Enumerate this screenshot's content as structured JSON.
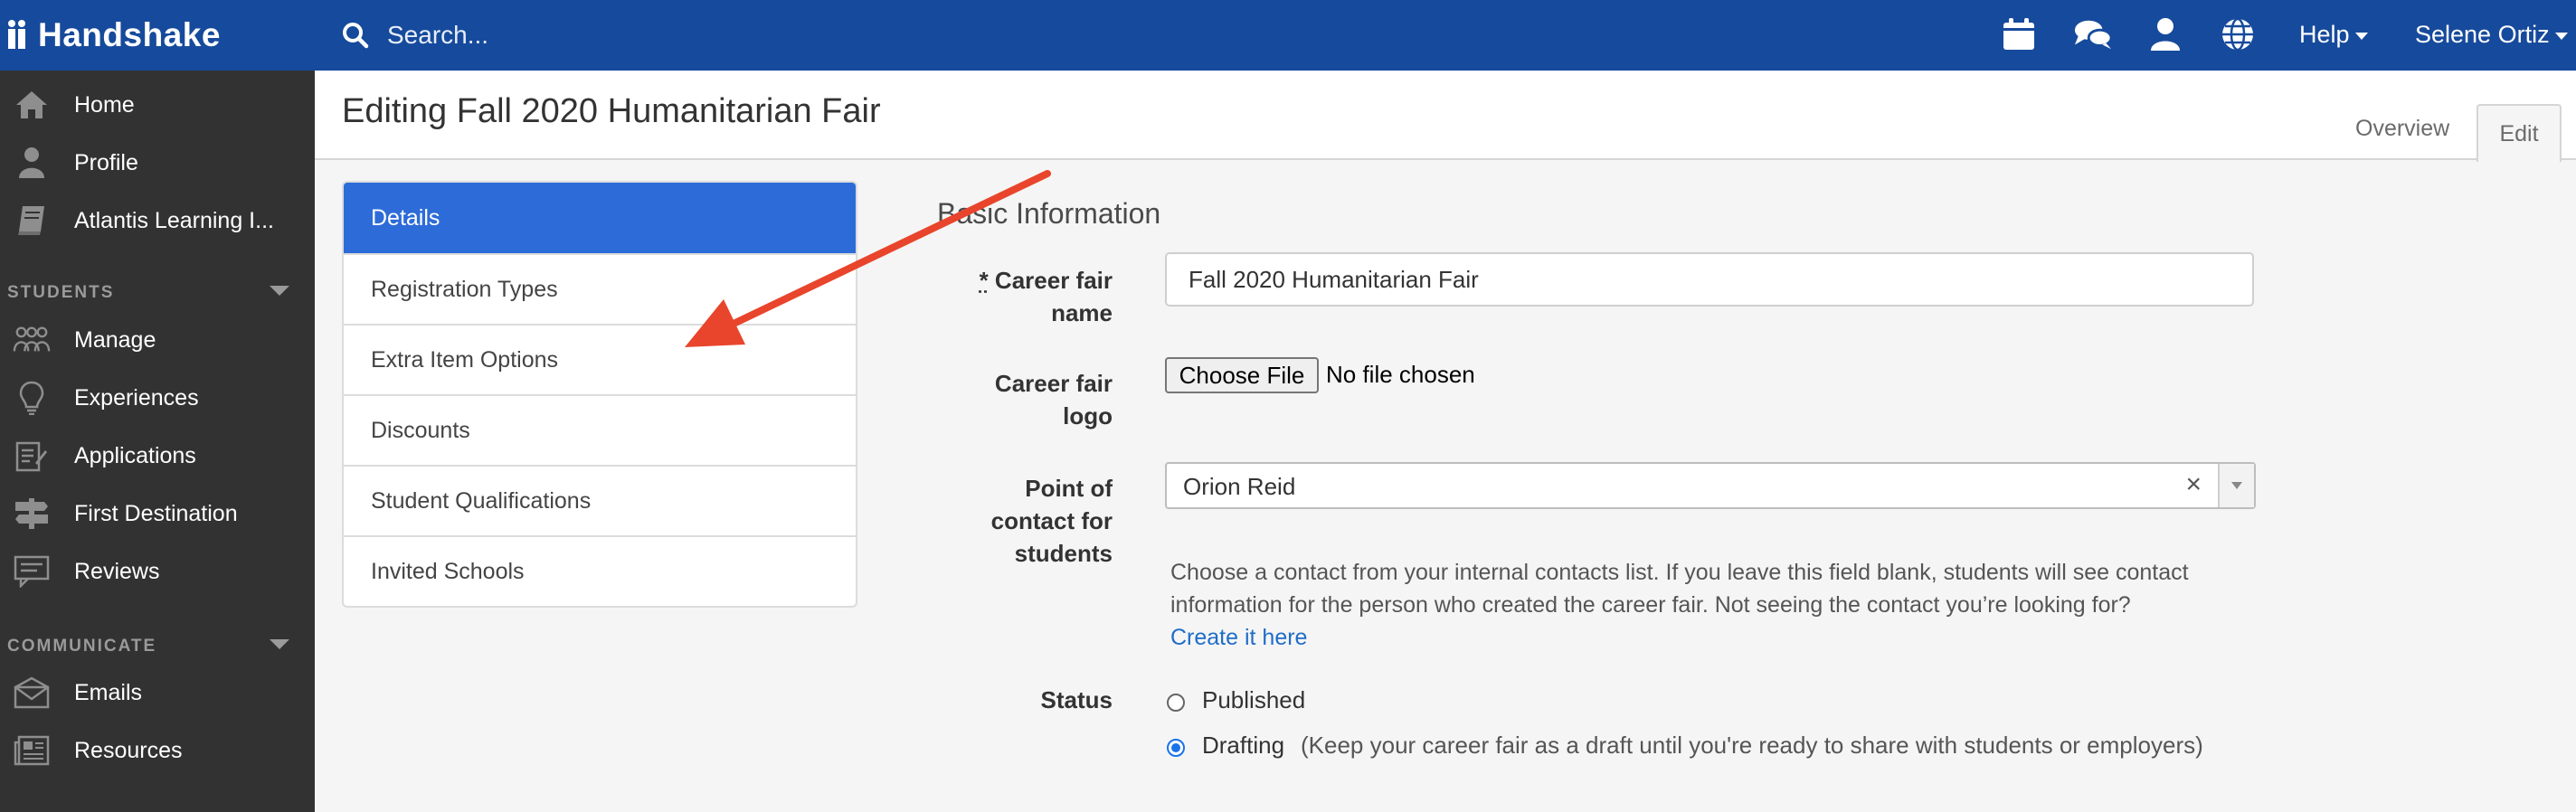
{
  "header": {
    "brand": "Handshake",
    "search_placeholder": "Search...",
    "icons": [
      "calendar-icon",
      "chat-icon",
      "user-icon",
      "globe-icon"
    ],
    "help_label": "Help",
    "user_name": "Selene Ortiz"
  },
  "sidebar": {
    "items": [
      {
        "label": "Home",
        "icon": "home-icon"
      },
      {
        "label": "Profile",
        "icon": "user-icon"
      },
      {
        "label": "Atlantis Learning I...",
        "icon": "book-icon"
      }
    ],
    "students_section": {
      "title": "STUDENTS",
      "items": [
        {
          "label": "Manage",
          "icon": "group-icon"
        },
        {
          "label": "Experiences",
          "icon": "lightbulb-icon"
        },
        {
          "label": "Applications",
          "icon": "document-icon"
        },
        {
          "label": "First Destination",
          "icon": "signpost-icon"
        },
        {
          "label": "Reviews",
          "icon": "review-icon"
        }
      ]
    },
    "communicate_section": {
      "title": "COMMUNICATE",
      "items": [
        {
          "label": "Emails",
          "icon": "envelope-icon"
        },
        {
          "label": "Resources",
          "icon": "newspaper-icon"
        }
      ]
    }
  },
  "page": {
    "title": "Editing Fall 2020 Humanitarian Fair",
    "tabs": [
      {
        "label": "Overview",
        "active": false
      },
      {
        "label": "Edit",
        "active": true
      }
    ]
  },
  "panel": {
    "items": [
      {
        "label": "Details",
        "active": true
      },
      {
        "label": "Registration Types",
        "active": false
      },
      {
        "label": "Extra Item Options",
        "active": false
      },
      {
        "label": "Discounts",
        "active": false
      },
      {
        "label": "Student Qualifications",
        "active": false
      },
      {
        "label": "Invited Schools",
        "active": false
      }
    ]
  },
  "form": {
    "section_title": "Basic Information",
    "name_field": {
      "required_mark": "*",
      "label_line1": "Career fair",
      "label_line2": "name",
      "value": "Fall 2020 Humanitarian Fair"
    },
    "logo_field": {
      "label_line1": "Career fair",
      "label_line2": "logo",
      "button_label": "Choose File",
      "status": "No file chosen"
    },
    "contact_field": {
      "label_line1": "Point of",
      "label_line2": "contact for",
      "label_line3": "students",
      "selected": "Orion Reid",
      "clear_symbol": "×",
      "help_text": "Choose a contact from your internal contacts list. If you leave this field blank, students will see contact information for the person who created the career fair. Not seeing the contact you’re looking for?",
      "help_link": "Create it here"
    },
    "status_field": {
      "label": "Status",
      "options": [
        {
          "label": "Published",
          "checked": false,
          "hint": ""
        },
        {
          "label": "Drafting",
          "checked": true,
          "hint": "(Keep your career fair as a draft until you're ready to share with students or employers)"
        }
      ]
    }
  },
  "colors": {
    "topbar": "#164a9c",
    "sidebar": "#323232",
    "active_item": "#2d6bd9",
    "link": "#1f6dc7",
    "annotation_arrow": "#e8452c"
  }
}
